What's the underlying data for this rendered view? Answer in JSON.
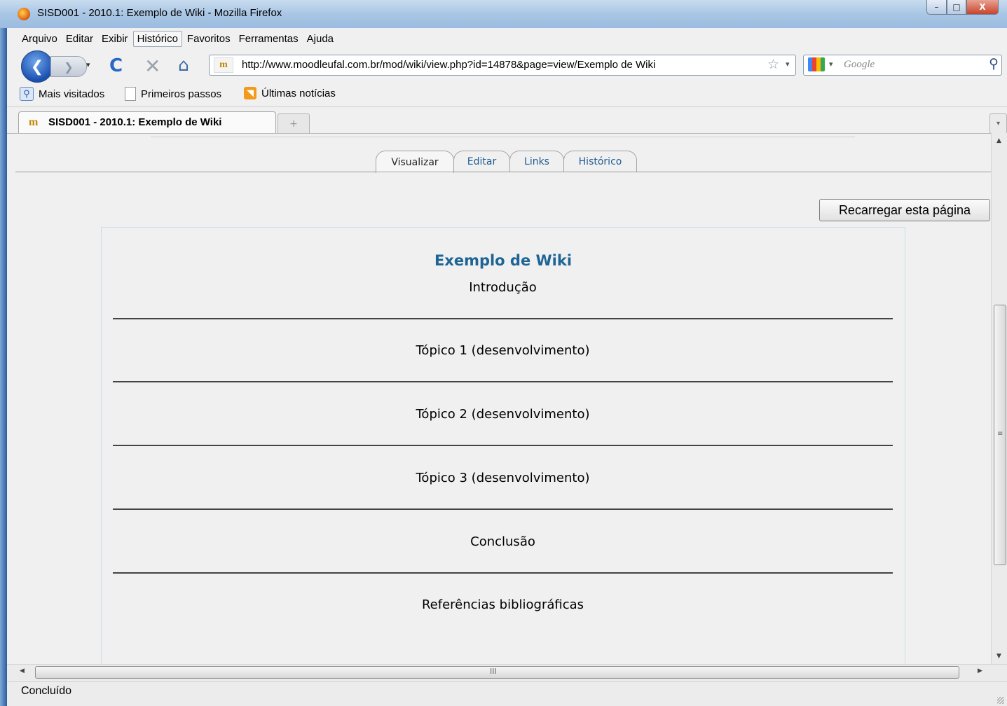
{
  "window": {
    "title": "SISD001 - 2010.1: Exemplo de Wiki - Mozilla Firefox",
    "min_glyph": "–",
    "max_glyph": "□",
    "close_glyph": "X"
  },
  "menu": [
    "Arquivo",
    "Editar",
    "Exibir",
    "Histórico",
    "Favoritos",
    "Ferramentas",
    "Ajuda"
  ],
  "nav": {
    "back_glyph": "❮",
    "forward_glyph": "❯",
    "dropdown_glyph": "▾",
    "reload_glyph": "C",
    "stop_glyph": "✕",
    "home_glyph": "⌂",
    "favicon_text": "m",
    "url": "http://www.moodleufal.com.br/mod/wiki/view.php?id=14878&page=view/Exemplo de Wiki",
    "star_glyph": "☆",
    "search_placeholder": "Google",
    "search_glyph": "⚲"
  },
  "bookmarks": [
    {
      "label": "Mais visitados",
      "icon": "magnifier-icon",
      "glyph": "⚲"
    },
    {
      "label": "Primeiros passos",
      "icon": "page-icon",
      "glyph": ""
    },
    {
      "label": "Últimas notícias",
      "icon": "rss-icon",
      "glyph": "◥"
    }
  ],
  "tabs": {
    "active_title": "SISD001 - 2010.1: Exemplo de Wiki",
    "favicon_text": "m",
    "new_tab_glyph": "+",
    "list_glyph": "▾"
  },
  "wiki": {
    "tabs": [
      "Visualizar",
      "Editar",
      "Links",
      "Histórico"
    ],
    "active_tab": "Visualizar",
    "reload_button": "Recarregar esta página",
    "title": "Exemplo de Wiki",
    "sections": [
      "Introdução",
      "Tópico 1 (desenvolvimento)",
      "Tópico 2 (desenvolvimento)",
      "Tópico 3 (desenvolvimento)",
      "Conclusão",
      "Referências bibliográficas"
    ]
  },
  "scroll": {
    "up_glyph": "▲",
    "down_glyph": "▼",
    "left_glyph": "◀",
    "right_glyph": "▶",
    "grip_v": "≡",
    "grip_h": "III"
  },
  "status": "Concluído",
  "colors": {
    "wiki_link": "#1f5c91",
    "wiki_title": "#1e6596"
  }
}
